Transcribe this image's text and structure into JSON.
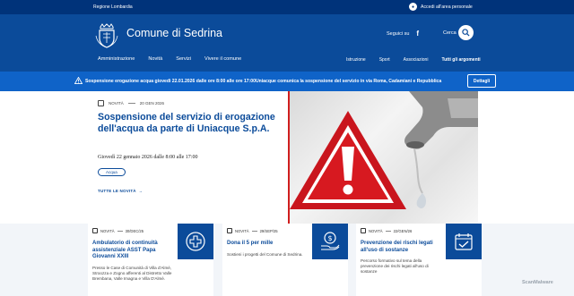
{
  "topbar": {
    "region": "Regione Lombardia",
    "access_label": "Accedi all'area personale"
  },
  "header": {
    "title": "Comune di Sedrina",
    "social_label": "Seguici su",
    "search_label": "Cerca",
    "nav": [
      "Amministrazione",
      "Novità",
      "Servizi",
      "Vivere il comune"
    ],
    "secondary_nav": [
      "Istruzione",
      "Sport",
      "Associazioni",
      "Tutti gli argomenti"
    ]
  },
  "alert": {
    "message": "Sospensione erogazione acqua giovedì 22.01.2026 dalle ore 8:00 alle ore 17:00Uniacque comunica la sospensione del servizio in via Roma, Cadamiani e Repubblica",
    "button": "Dettagli"
  },
  "hero": {
    "category": "NOVITÀ",
    "date": "20 GEN 2026",
    "headline": "Sospensione del servizio di erogazione dell'acqua da parte di Uniacque S.p.A.",
    "subtitle": "Giovedì 22 gennaio 2026 dalle 8:00 alle 17:00",
    "tag": "Acqua",
    "more_link": "TUTTE LE NOVITÀ"
  },
  "cards": [
    {
      "category": "NOVITÀ",
      "date": "30/DEC/25",
      "title": "Ambulatorio di continuità assistenziale ASST Papa Giovanni XXIII",
      "body": "Presso le Case di Comunità di Villa d'Almè, Stroozza e Zogno afferenti al Distretto Valle Brembana, Valle Imagna e Villa D'Almè.",
      "icon": "medical-cross-icon"
    },
    {
      "category": "NOVITÀ",
      "date": "29/SEP/25",
      "title": "Dona il 5 per mille",
      "body": "Sostieni i progetti del Comune di Sedrina.",
      "icon": "donation-hand-icon"
    },
    {
      "category": "NOVITÀ",
      "date": "22/GEN/26",
      "title": "Prevenzione dei rischi legati all'uso di sostanze",
      "body": "Percorso formativo sul tema della prevenzione dei rischi legati all'uso di sostanze",
      "icon": "calendar-check-icon"
    }
  ],
  "watermark": "ScanMalware",
  "colors": {
    "primary": "#0b4b9a",
    "topbar": "#00337a",
    "alert": "#0f63c8",
    "warning_red": "#d01e1e"
  }
}
